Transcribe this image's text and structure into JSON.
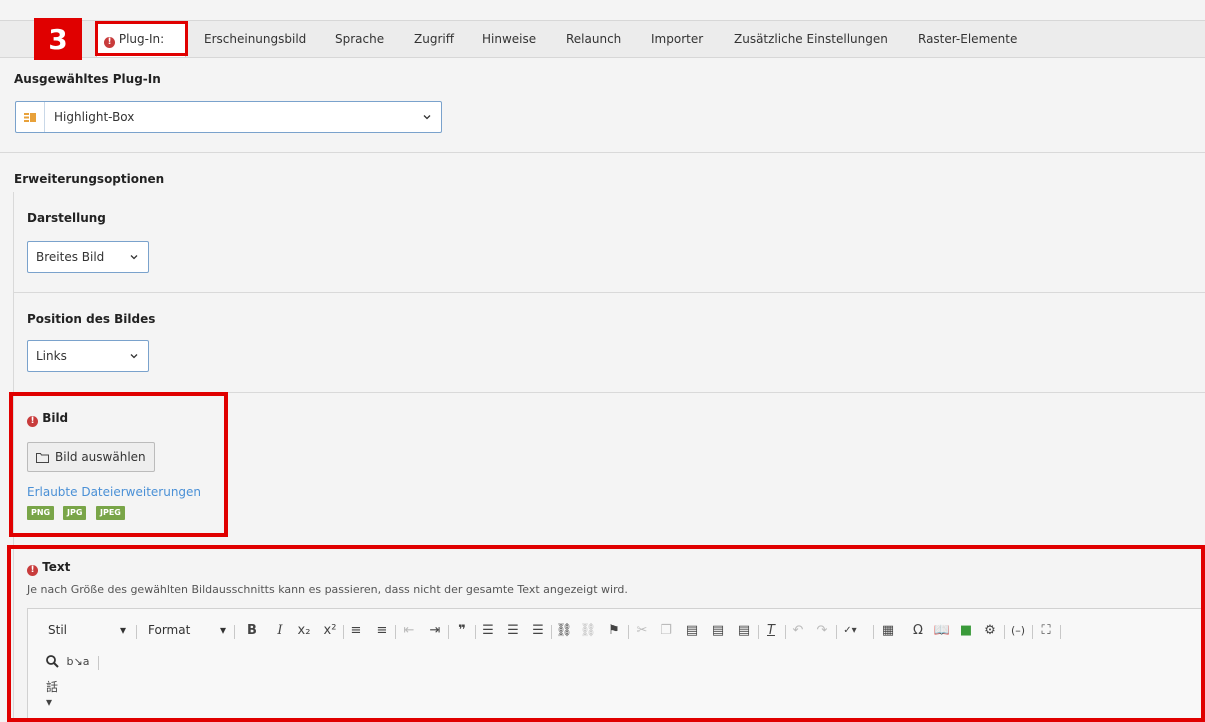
{
  "step_number": "3",
  "tabs": [
    {
      "label": "Plug-In:",
      "active": true,
      "error": true
    },
    {
      "label": "Erscheinungsbild"
    },
    {
      "label": "Sprache"
    },
    {
      "label": "Zugriff"
    },
    {
      "label": "Hinweise"
    },
    {
      "label": "Relaunch"
    },
    {
      "label": "Importer"
    },
    {
      "label": "Zusätzliche Einstellungen"
    },
    {
      "label": "Raster-Elemente"
    }
  ],
  "plugin": {
    "heading": "Ausgewähltes Plug-In",
    "selected": "Highlight-Box"
  },
  "extensions": {
    "heading": "Erweiterungsoptionen",
    "darstellung": {
      "label": "Darstellung",
      "selected": "Breites Bild"
    },
    "position": {
      "label": "Position des Bildes",
      "selected": "Links"
    }
  },
  "bild": {
    "label": "Bild",
    "button_label": "Bild auswählen",
    "allowed_link": "Erlaubte Dateierweiterungen",
    "extensions": [
      "PNG",
      "JPG",
      "JPEG"
    ]
  },
  "text": {
    "label": "Text",
    "hint": "Je nach Größe des gewählten Bildausschnitts kann es passieren, dass nicht der gesamte Text angezeigt wird.",
    "toolbar": {
      "style_label": "Stil",
      "format_label": "Format"
    }
  },
  "colors": {
    "highlight": "#e00000",
    "error": "#c83c3c",
    "badge": "#79a548",
    "link": "#4a90d6"
  }
}
